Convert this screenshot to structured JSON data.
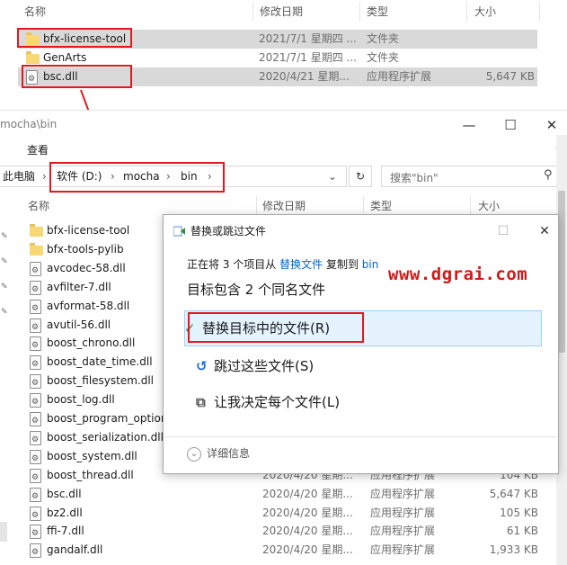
{
  "columns": {
    "name": "名称",
    "modified": "修改日期",
    "type": "类型",
    "size": "大小"
  },
  "top_files": [
    {
      "name": "bfx-license-tool",
      "icon": "folder-icon",
      "modified": "2021/7/1 星期四 ...",
      "type": "文件夹",
      "size": ""
    },
    {
      "name": "GenArts",
      "icon": "folder-icon",
      "modified": "2021/7/1 星期四 ...",
      "type": "文件夹",
      "size": ""
    },
    {
      "name": "bsc.dll",
      "icon": "dll-icon",
      "modified": "2020/4/21 星期...",
      "type": "应用程序扩展",
      "size": "5,647 KB"
    }
  ],
  "window": {
    "title": "mocha\\bin",
    "minimize_icon": "minimize-icon",
    "maximize_icon": "maximize-icon",
    "close_icon": "close-icon"
  },
  "ribbon": {
    "view_tab": "查看"
  },
  "address": {
    "crumbs": [
      "此电脑",
      "软件 (D:)",
      "mocha",
      "bin"
    ],
    "search_placeholder": "搜索\"bin\""
  },
  "files": [
    {
      "name": "bfx-license-tool",
      "icon": "folder-icon",
      "modified": "",
      "type": "",
      "size": ""
    },
    {
      "name": "bfx-tools-pylib",
      "icon": "folder-icon",
      "modified": "",
      "type": "",
      "size": ""
    },
    {
      "name": "avcodec-58.dll",
      "icon": "dll-icon",
      "modified": "",
      "type": "",
      "size": ""
    },
    {
      "name": "avfilter-7.dll",
      "icon": "dll-icon",
      "modified": "",
      "type": "",
      "size": ""
    },
    {
      "name": "avformat-58.dll",
      "icon": "dll-icon",
      "modified": "",
      "type": "",
      "size": ""
    },
    {
      "name": "avutil-56.dll",
      "icon": "dll-icon",
      "modified": "",
      "type": "",
      "size": ""
    },
    {
      "name": "boost_chrono.dll",
      "icon": "dll-icon",
      "modified": "",
      "type": "",
      "size": ""
    },
    {
      "name": "boost_date_time.dll",
      "icon": "dll-icon",
      "modified": "",
      "type": "",
      "size": ""
    },
    {
      "name": "boost_filesystem.dll",
      "icon": "dll-icon",
      "modified": "",
      "type": "",
      "size": ""
    },
    {
      "name": "boost_log.dll",
      "icon": "dll-icon",
      "modified": "",
      "type": "",
      "size": ""
    },
    {
      "name": "boost_program_option",
      "icon": "dll-icon",
      "modified": "",
      "type": "",
      "size": ""
    },
    {
      "name": "boost_serialization.dll",
      "icon": "dll-icon",
      "modified": "",
      "type": "",
      "size": ""
    },
    {
      "name": "boost_system.dll",
      "icon": "dll-icon",
      "modified": "",
      "type": "",
      "size": ""
    },
    {
      "name": "boost_thread.dll",
      "icon": "dll-icon",
      "modified": "2020/4/20 星期...",
      "type": "应用程序扩展",
      "size": "104 KB"
    },
    {
      "name": "bsc.dll",
      "icon": "dll-icon",
      "modified": "2020/4/20 星期...",
      "type": "应用程序扩展",
      "size": "5,647 KB"
    },
    {
      "name": "bz2.dll",
      "icon": "dll-icon",
      "modified": "2020/4/20 星期...",
      "type": "应用程序扩展",
      "size": "105 KB"
    },
    {
      "name": "ffi-7.dll",
      "icon": "dll-icon",
      "modified": "2020/4/20 星期...",
      "type": "应用程序扩展",
      "size": "61 KB"
    },
    {
      "name": "gandalf.dll",
      "icon": "dll-icon",
      "modified": "2020/4/20 星期...",
      "type": "应用程序扩展",
      "size": "1,933 KB"
    }
  ],
  "dialog": {
    "title": "替换或跳过文件",
    "status_prefix": "正在将 3 个项目从",
    "source": "替换文件",
    "status_mid": "复制到",
    "destination": "bin",
    "heading": "目标包含 2 个同名文件",
    "replace_option": "替换目标中的文件(R)",
    "skip_option": "跳过这些文件(S)",
    "decide_option": "让我决定每个文件(L)",
    "details": "详细信息"
  },
  "watermark": "www.dgrai.com",
  "colors": {
    "highlight_red": "#e4181d",
    "selection_gray": "#d9d9d9",
    "option_hover": "#e5f3ff",
    "option_border": "#99d1ff",
    "link_blue": "#0066cc",
    "folder_yellow": "#f8d775",
    "check_green": "#2e8b3a"
  }
}
